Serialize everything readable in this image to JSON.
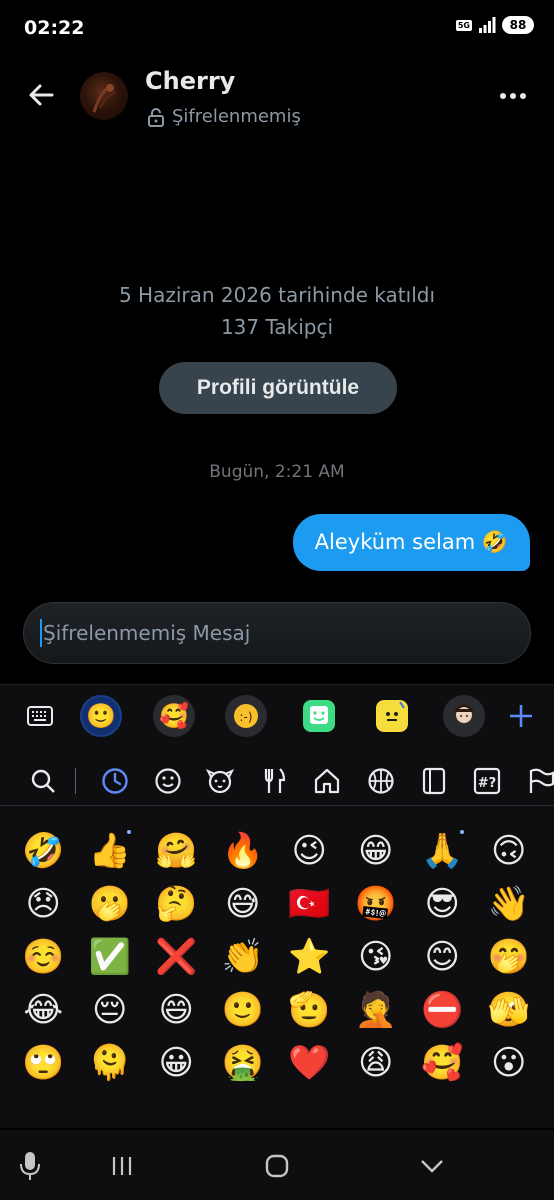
{
  "status_bar": {
    "time": "02:22",
    "network": "5G",
    "battery": "88"
  },
  "header": {
    "contact_name": "Cherry",
    "encryption_status": "Şifrelenmemiş"
  },
  "profile": {
    "joined_text": "5 Haziran 2026 tarihinde katıldı",
    "followers_text": "137 Takipçi",
    "view_profile_label": "Profili görüntüle"
  },
  "conversation": {
    "timestamp": "Bugün, 2:21 AM",
    "messages": [
      {
        "text": "Aleyküm selam 🤣",
        "sender": "me"
      }
    ]
  },
  "composer": {
    "placeholder": "Şifrelenmemiş Mesaj"
  },
  "keyboard": {
    "top_row": [
      "keyboard-icon",
      "emoji-icon",
      "sticker-icon",
      "emoticon-icon",
      "gif-icon",
      "ar-emoji-icon",
      "avatar-icon",
      "plus-icon"
    ],
    "categories": [
      "search-icon",
      "recent-icon",
      "smileys-icon",
      "animals-icon",
      "food-icon",
      "places-icon",
      "activities-icon",
      "objects-icon",
      "symbols-icon",
      "flags-icon"
    ],
    "emojis": [
      "🤣",
      "👍",
      "🤗",
      "🔥",
      "😉",
      "😁",
      "🙏",
      "🙃",
      "😞",
      "🫢",
      "🤔",
      "😅",
      "🇹🇷",
      "🤬",
      "😎",
      "👋",
      "☺️",
      "✅",
      "❌",
      "👏",
      "⭐",
      "😘",
      "😊",
      "🤭",
      "😂",
      "😔",
      "😄",
      "🙂",
      "🫡",
      "🤦",
      "⛔",
      "🫣",
      "🙄",
      "🫠",
      "😀",
      "🤮",
      "❤️",
      "😩",
      "🥰",
      "😮"
    ]
  },
  "colors": {
    "accent": "#1d9bf0",
    "background": "#000000",
    "secondary_text": "#8b98a5"
  }
}
